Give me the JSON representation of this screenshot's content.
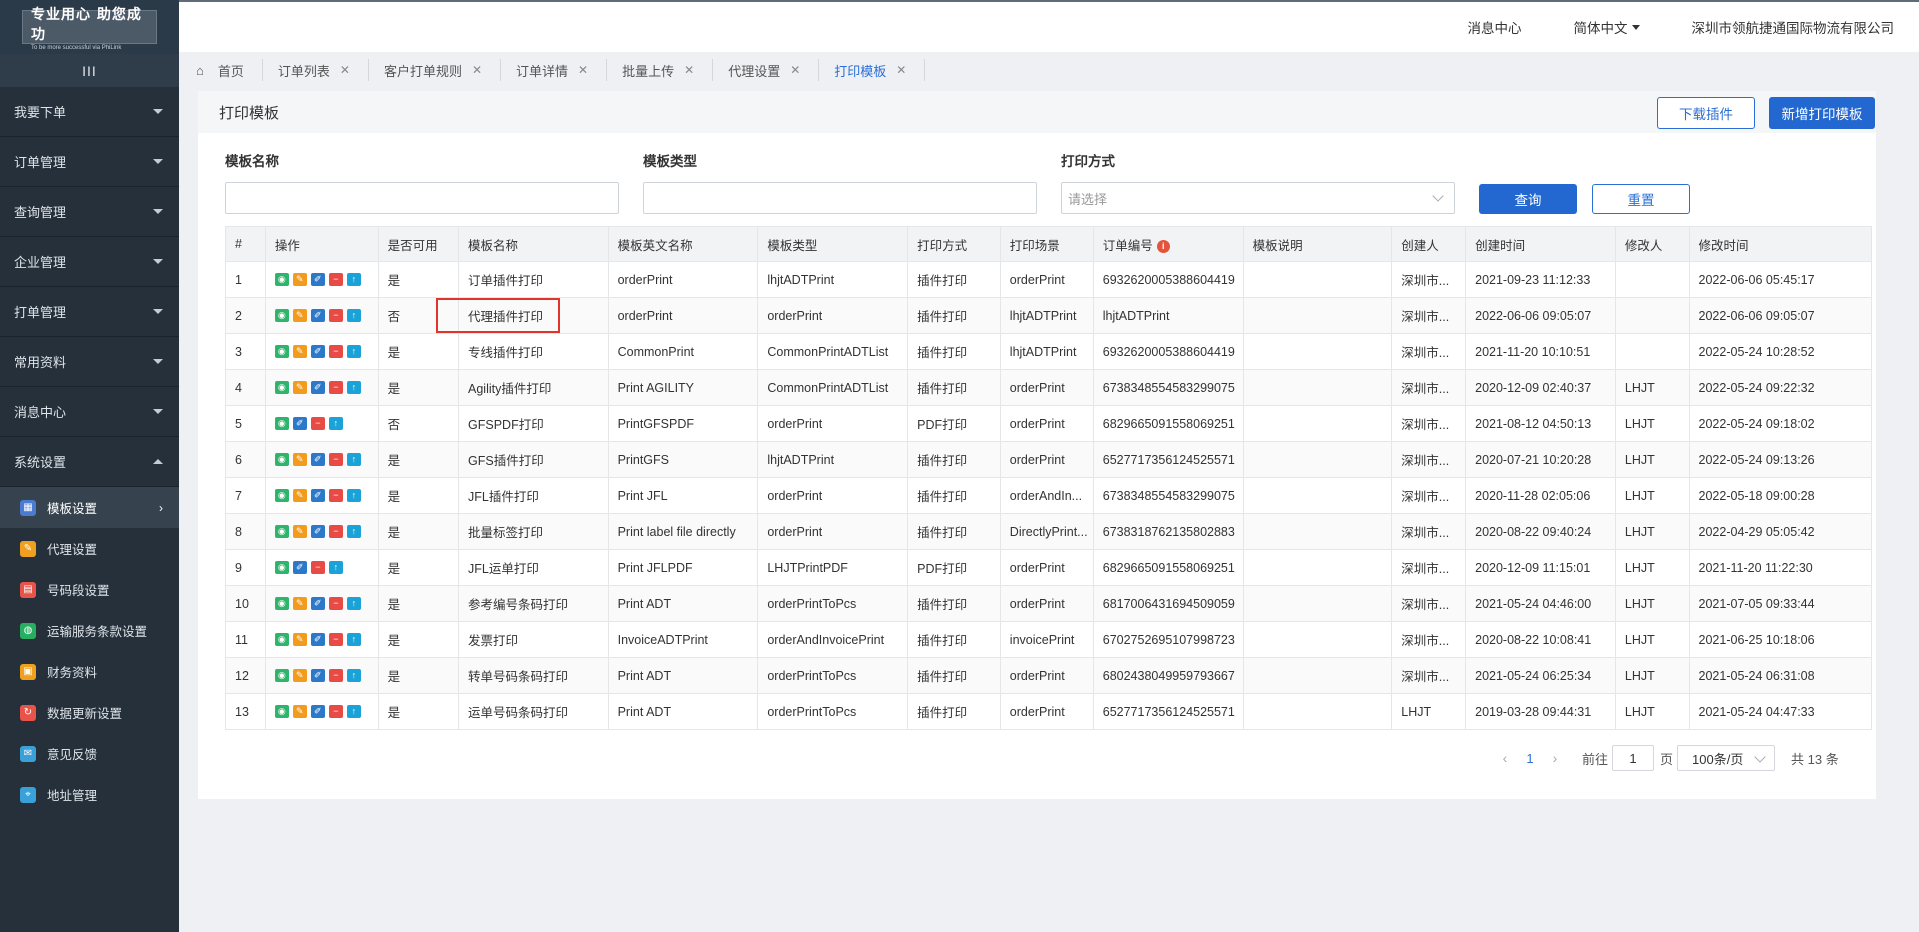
{
  "logo": {
    "main": "专业用心 助您成功",
    "sub": "To be more successful via PhiLink"
  },
  "sidebar": {
    "collapse_label": "III",
    "menus": [
      {
        "label": "我要下单"
      },
      {
        "label": "订单管理"
      },
      {
        "label": "查询管理"
      },
      {
        "label": "企业管理"
      },
      {
        "label": "打单管理"
      },
      {
        "label": "常用资料"
      },
      {
        "label": "消息中心"
      },
      {
        "label": "系统设置"
      }
    ],
    "sub_items": [
      {
        "label": "模板设置",
        "icon": "template-icon",
        "color": "#4a7bd0"
      },
      {
        "label": "代理设置",
        "icon": "agent-icon",
        "color": "#f0a020"
      },
      {
        "label": "号码段设置",
        "icon": "number-icon",
        "color": "#e8534a"
      },
      {
        "label": "运输服务条款设置",
        "icon": "transport-icon",
        "color": "#27ae60"
      },
      {
        "label": "财务资料",
        "icon": "finance-icon",
        "color": "#f0a020"
      },
      {
        "label": "数据更新设置",
        "icon": "refresh-icon",
        "color": "#e8534a"
      },
      {
        "label": "意见反馈",
        "icon": "feedback-icon",
        "color": "#3aa0d8"
      },
      {
        "label": "地址管理",
        "icon": "address-icon",
        "color": "#3aa0d8"
      }
    ]
  },
  "header": {
    "messages": "消息中心",
    "language": "简体中文",
    "company": "深圳市领航捷通国际物流有限公司"
  },
  "tabs": [
    {
      "label": "首页"
    },
    {
      "label": "订单列表"
    },
    {
      "label": "客户打单规则"
    },
    {
      "label": "订单详情"
    },
    {
      "label": "批量上传"
    },
    {
      "label": "代理设置"
    },
    {
      "label": "打印模板"
    }
  ],
  "page": {
    "title": "打印模板",
    "download_btn": "下载插件",
    "add_btn": "新增打印模板",
    "filters": {
      "name_label": "模板名称",
      "type_label": "模板类型",
      "method_label": "打印方式",
      "method_placeholder": "请选择",
      "query_btn": "查询",
      "reset_btn": "重置"
    }
  },
  "table": {
    "headers": [
      "#",
      "操作",
      "是否可用",
      "模板名称",
      "模板英文名称",
      "模板类型",
      "打印方式",
      "打印场景",
      "订单编号",
      "模板说明",
      "创建人",
      "创建时间",
      "修改人",
      "修改时间"
    ],
    "rows": [
      {
        "no": "1",
        "ops": 5,
        "enabled": "是",
        "name": "订单插件打印",
        "en": "orderPrint",
        "type": "lhjtADTPrint",
        "method": "插件打印",
        "scene": "orderPrint",
        "order": "6932620005388604419",
        "desc": "",
        "creator": "深圳市...",
        "created": "2021-09-23 11:12:33",
        "modifier": "",
        "modified": "2022-06-06 05:45:17"
      },
      {
        "no": "2",
        "ops": 5,
        "enabled": "否",
        "name": "代理插件打印",
        "en": "orderPrint",
        "type": "orderPrint",
        "method": "插件打印",
        "scene": "lhjtADTPrint",
        "order": "lhjtADTPrint",
        "desc": "",
        "creator": "深圳市...",
        "created": "2022-06-06 09:05:07",
        "modifier": "",
        "modified": "2022-06-06 09:05:07"
      },
      {
        "no": "3",
        "ops": 5,
        "enabled": "是",
        "name": "专线插件打印",
        "en": "CommonPrint",
        "type": "CommonPrintADTList",
        "method": "插件打印",
        "scene": "lhjtADTPrint",
        "order": "6932620005388604419",
        "desc": "",
        "creator": "深圳市...",
        "created": "2021-11-20 10:10:51",
        "modifier": "",
        "modified": "2022-05-24 10:28:52"
      },
      {
        "no": "4",
        "ops": 5,
        "enabled": "是",
        "name": "Agility插件打印",
        "en": "Print AGILITY",
        "type": "CommonPrintADTList",
        "method": "插件打印",
        "scene": "orderPrint",
        "order": "6738348554583299075",
        "desc": "",
        "creator": "深圳市...",
        "created": "2020-12-09 02:40:37",
        "modifier": "LHJT",
        "modified": "2022-05-24 09:22:32"
      },
      {
        "no": "5",
        "ops": 4,
        "enabled": "否",
        "name": "GFSPDF打印",
        "en": "PrintGFSPDF",
        "type": "orderPrint",
        "method": "PDF打印",
        "scene": "orderPrint",
        "order": "6829665091558069251",
        "desc": "",
        "creator": "深圳市...",
        "created": "2021-08-12 04:50:13",
        "modifier": "LHJT",
        "modified": "2022-05-24 09:18:02"
      },
      {
        "no": "6",
        "ops": 5,
        "enabled": "是",
        "name": "GFS插件打印",
        "en": "PrintGFS",
        "type": "lhjtADTPrint",
        "method": "插件打印",
        "scene": "orderPrint",
        "order": "6527717356124525571",
        "desc": "",
        "creator": "深圳市...",
        "created": "2020-07-21 10:20:28",
        "modifier": "LHJT",
        "modified": "2022-05-24 09:13:26"
      },
      {
        "no": "7",
        "ops": 5,
        "enabled": "是",
        "name": "JFL插件打印",
        "en": "Print JFL",
        "type": "orderPrint",
        "method": "插件打印",
        "scene": "orderAndIn...",
        "order": "6738348554583299075",
        "desc": "",
        "creator": "深圳市...",
        "created": "2020-11-28 02:05:06",
        "modifier": "LHJT",
        "modified": "2022-05-18 09:00:28"
      },
      {
        "no": "8",
        "ops": 5,
        "enabled": "是",
        "name": "批量标签打印",
        "en": "Print label file directly",
        "type": "orderPrint",
        "method": "插件打印",
        "scene": "DirectlyPrint...",
        "order": "6738318762135802883",
        "desc": "",
        "creator": "深圳市...",
        "created": "2020-08-22 09:40:24",
        "modifier": "LHJT",
        "modified": "2022-04-29 05:05:42"
      },
      {
        "no": "9",
        "ops": 4,
        "enabled": "是",
        "name": "JFL运单打印",
        "en": "Print JFLPDF",
        "type": "LHJTPrintPDF",
        "method": "PDF打印",
        "scene": "orderPrint",
        "order": "6829665091558069251",
        "desc": "",
        "creator": "深圳市...",
        "created": "2020-12-09 11:15:01",
        "modifier": "LHJT",
        "modified": "2021-11-20 11:22:30"
      },
      {
        "no": "10",
        "ops": 5,
        "enabled": "是",
        "name": "参考编号条码打印",
        "en": "Print ADT",
        "type": "orderPrintToPcs",
        "method": "插件打印",
        "scene": "orderPrint",
        "order": "6817006431694509059",
        "desc": "",
        "creator": "深圳市...",
        "created": "2021-05-24 04:46:00",
        "modifier": "LHJT",
        "modified": "2021-07-05 09:33:44"
      },
      {
        "no": "11",
        "ops": 5,
        "enabled": "是",
        "name": "发票打印",
        "en": "InvoiceADTPrint",
        "type": "orderAndInvoicePrint",
        "method": "插件打印",
        "scene": "invoicePrint",
        "order": "6702752695107998723",
        "desc": "",
        "creator": "深圳市...",
        "created": "2020-08-22 10:08:41",
        "modifier": "LHJT",
        "modified": "2021-06-25 10:18:06"
      },
      {
        "no": "12",
        "ops": 5,
        "enabled": "是",
        "name": "转单号码条码打印",
        "en": "Print ADT",
        "type": "orderPrintToPcs",
        "method": "插件打印",
        "scene": "orderPrint",
        "order": "6802438049959793667",
        "desc": "",
        "creator": "深圳市...",
        "created": "2021-05-24 06:25:34",
        "modifier": "LHJT",
        "modified": "2021-05-24 06:31:08"
      },
      {
        "no": "13",
        "ops": 5,
        "enabled": "是",
        "name": "运单号码条码打印",
        "en": "Print ADT",
        "type": "orderPrintToPcs",
        "method": "插件打印",
        "scene": "orderPrint",
        "order": "6527717356124525571",
        "desc": "",
        "creator": "LHJT",
        "created": "2019-03-28 09:44:31",
        "modifier": "LHJT",
        "modified": "2021-05-24 04:47:33"
      }
    ]
  },
  "pager": {
    "current": "1",
    "goto_label": "前往",
    "page_input": "1",
    "page_suffix": "页",
    "page_size": "100条/页",
    "total": "共 13 条"
  }
}
